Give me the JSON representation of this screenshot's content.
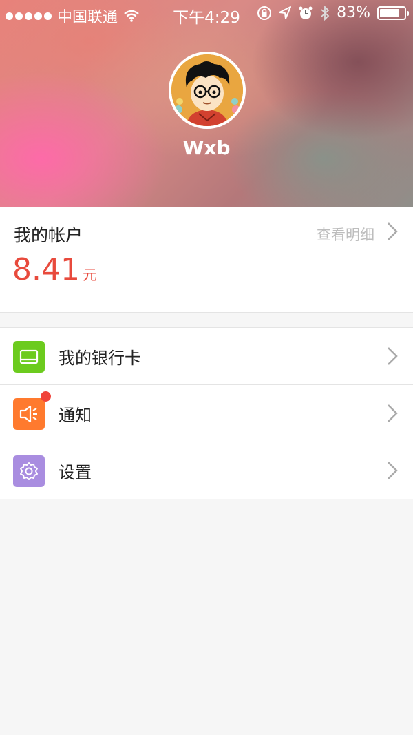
{
  "status_bar": {
    "carrier": "中国联通",
    "time": "下午4:29",
    "battery_percent": "83%",
    "battery_level": 0.83,
    "icons": [
      "signal-dots-icon",
      "wifi-icon",
      "rotation-lock-icon",
      "location-icon",
      "alarm-icon",
      "bluetooth-icon",
      "battery-icon"
    ]
  },
  "profile": {
    "username": "Wxb",
    "avatar": "avatar-cartoon-boy"
  },
  "account": {
    "title": "我的帐户",
    "detail_link": "查看明细",
    "balance": "8.41",
    "unit": "元"
  },
  "menu": {
    "items": [
      {
        "label": "我的银行卡",
        "icon": "bank-card-icon",
        "color": "#6ccb1e",
        "badge": false
      },
      {
        "label": "通知",
        "icon": "speaker-icon",
        "color": "#ff7a2e",
        "badge": true
      },
      {
        "label": "设置",
        "icon": "gear-icon",
        "color": "#a98de0",
        "badge": false
      }
    ]
  },
  "colors": {
    "accent_red": "#e84a3c",
    "badge_red": "#f0433a",
    "background": "#f6f6f6"
  }
}
